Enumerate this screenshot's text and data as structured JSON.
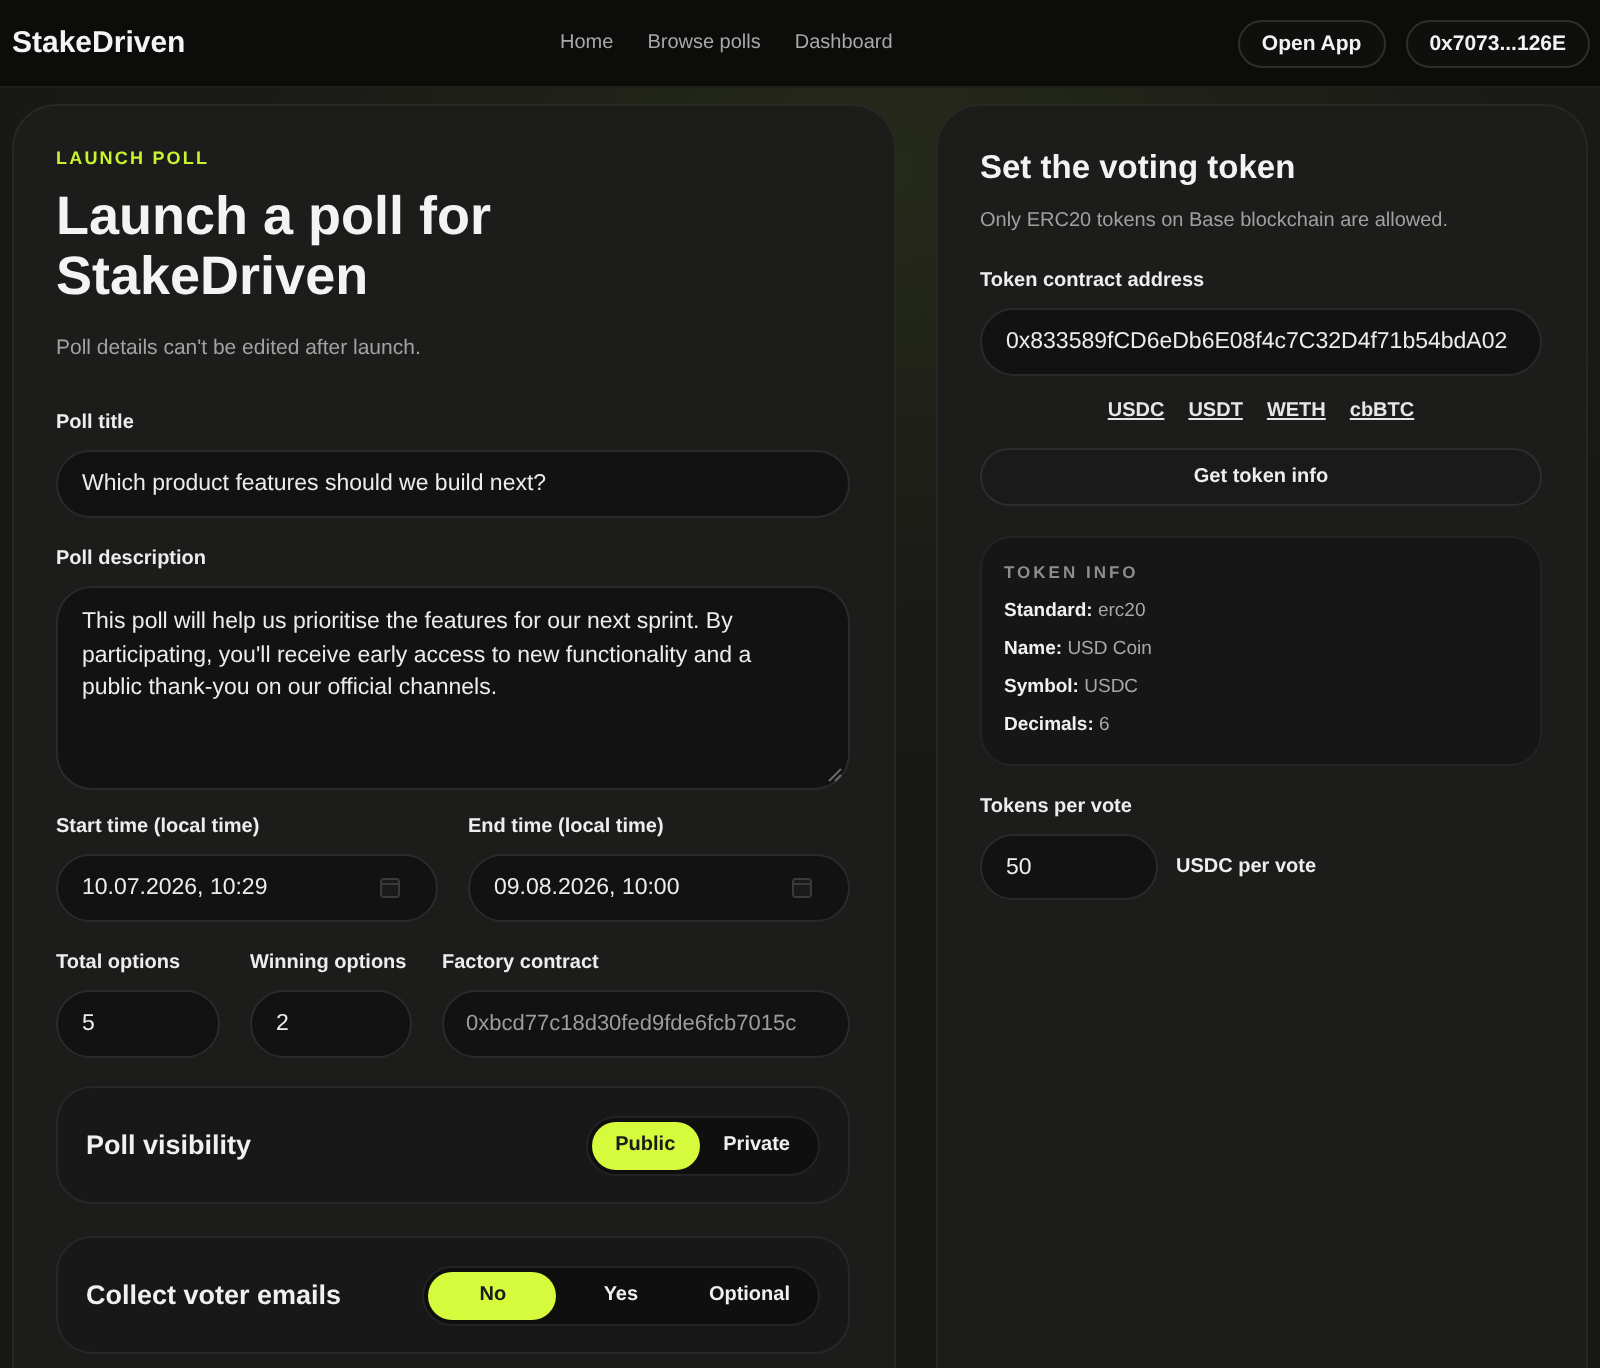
{
  "header": {
    "logo": "StakeDriven",
    "nav": [
      "Home",
      "Browse polls",
      "Dashboard"
    ],
    "buttons": [
      "Open App",
      "0x7073...126E"
    ]
  },
  "launch_form": {
    "eyebrow": "LAUNCH POLL",
    "title": "Launch a poll for StakeDriven",
    "subtitle": "Poll details can't be edited after launch.",
    "poll_title": {
      "label": "Poll title",
      "value": "Which product features should we build next?"
    },
    "poll_description": {
      "label": "Poll description",
      "value": "This poll will help us prioritise the features for our next sprint. By participating, you'll receive early access to new functionality and a public thank-you on our official channels."
    },
    "schedule": [
      {
        "label": "Start time (local time)",
        "value": "10.07.2026, 10:29"
      },
      {
        "label": "End time (local time)",
        "value": "09.08.2026, 10:00"
      }
    ],
    "options": [
      {
        "label": "Total options",
        "value": "5",
        "readonly": false
      },
      {
        "label": "Winning options",
        "value": "2",
        "readonly": false
      },
      {
        "label": "Factory contract",
        "value": "0xbcd77c18d30fed9fde6fcb7015c",
        "readonly": true
      }
    ],
    "settings": [
      {
        "label": "Poll visibility",
        "options": [
          {
            "label": "Public",
            "selected": true
          },
          {
            "label": "Private",
            "selected": false
          }
        ]
      },
      {
        "label": "Collect voter emails",
        "options": [
          {
            "label": "No",
            "selected": true
          },
          {
            "label": "Yes",
            "selected": false
          },
          {
            "label": "Optional",
            "selected": false
          }
        ]
      }
    ]
  },
  "voting_token": {
    "title": "Set the voting token",
    "subtitle": "Only ERC20 tokens on Base blockchain are allowed.",
    "address": {
      "label": "Token contract address",
      "value": "0x833589fCD6eDb6E08f4c7C32D4f71b54bdA02"
    },
    "presets": [
      "USDC",
      "USDT",
      "WETH",
      "cbBTC"
    ],
    "fetch_button": "Get token info",
    "token_info": {
      "heading": "TOKEN INFO",
      "rows": [
        {
          "label": "Standard:",
          "value": "erc20"
        },
        {
          "label": "Name:",
          "value": "USD Coin"
        },
        {
          "label": "Symbol:",
          "value": "USDC"
        },
        {
          "label": "Decimals:",
          "value": "6"
        }
      ]
    },
    "tokens_per_vote": {
      "label": "Tokens per vote",
      "value": "50",
      "unit": "USDC per vote"
    }
  }
}
